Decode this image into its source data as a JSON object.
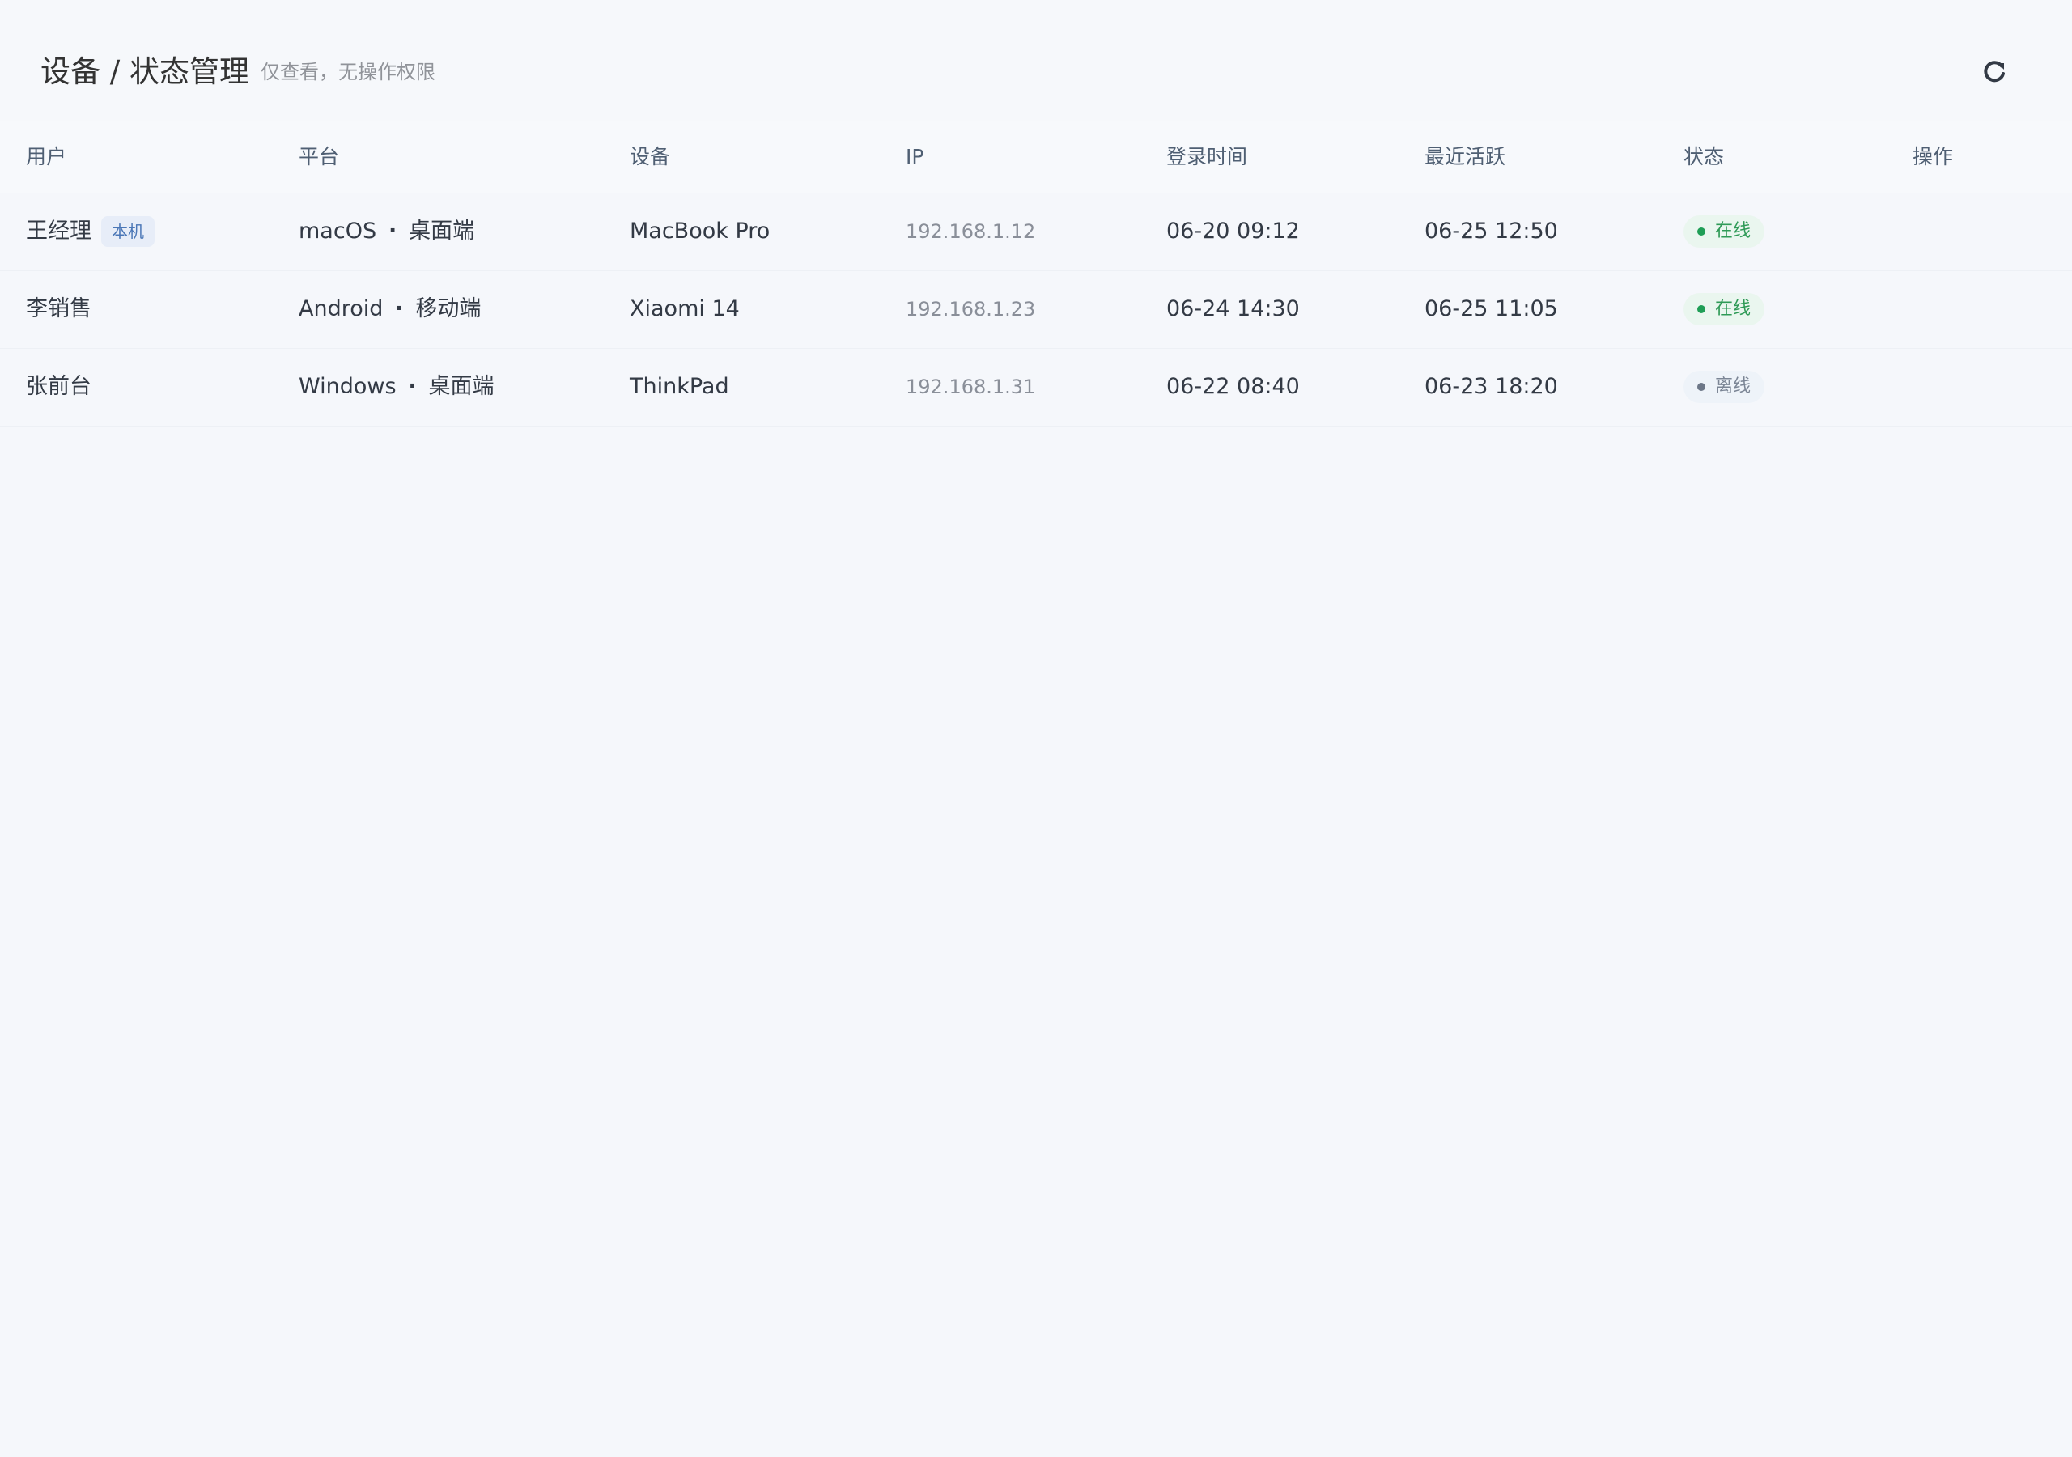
{
  "header": {
    "title": "设备 / 状态管理",
    "subtitle": "仅查看，无操作权限",
    "refresh_icon": "refresh-icon"
  },
  "table": {
    "columns": [
      "用户",
      "平台",
      "设备",
      "IP",
      "登录时间",
      "最近活跃",
      "状态",
      "操作"
    ],
    "rows": [
      {
        "user": "王经理",
        "local_badge": "本机",
        "platform": "macOS",
        "platform_type": "桌面端",
        "device": "MacBook Pro",
        "ip": "192.168.1.12",
        "login_time": "06-20 09:12",
        "last_active": "06-25 12:50",
        "status": "在线",
        "status_key": "online",
        "actions": ""
      },
      {
        "user": "李销售",
        "platform": "Android",
        "platform_type": "移动端",
        "device": "Xiaomi 14",
        "ip": "192.168.1.23",
        "login_time": "06-24 14:30",
        "last_active": "06-25 11:05",
        "status": "在线",
        "status_key": "online",
        "actions": ""
      },
      {
        "user": "张前台",
        "platform": "Windows",
        "platform_type": "桌面端",
        "device": "ThinkPad",
        "ip": "192.168.1.31",
        "login_time": "06-22 08:40",
        "last_active": "06-23 18:20",
        "status": "离线",
        "status_key": "offline",
        "actions": ""
      }
    ]
  },
  "colors": {
    "online": "#1f9e56",
    "offline": "#6d7788",
    "badge": "#4b77b7"
  }
}
